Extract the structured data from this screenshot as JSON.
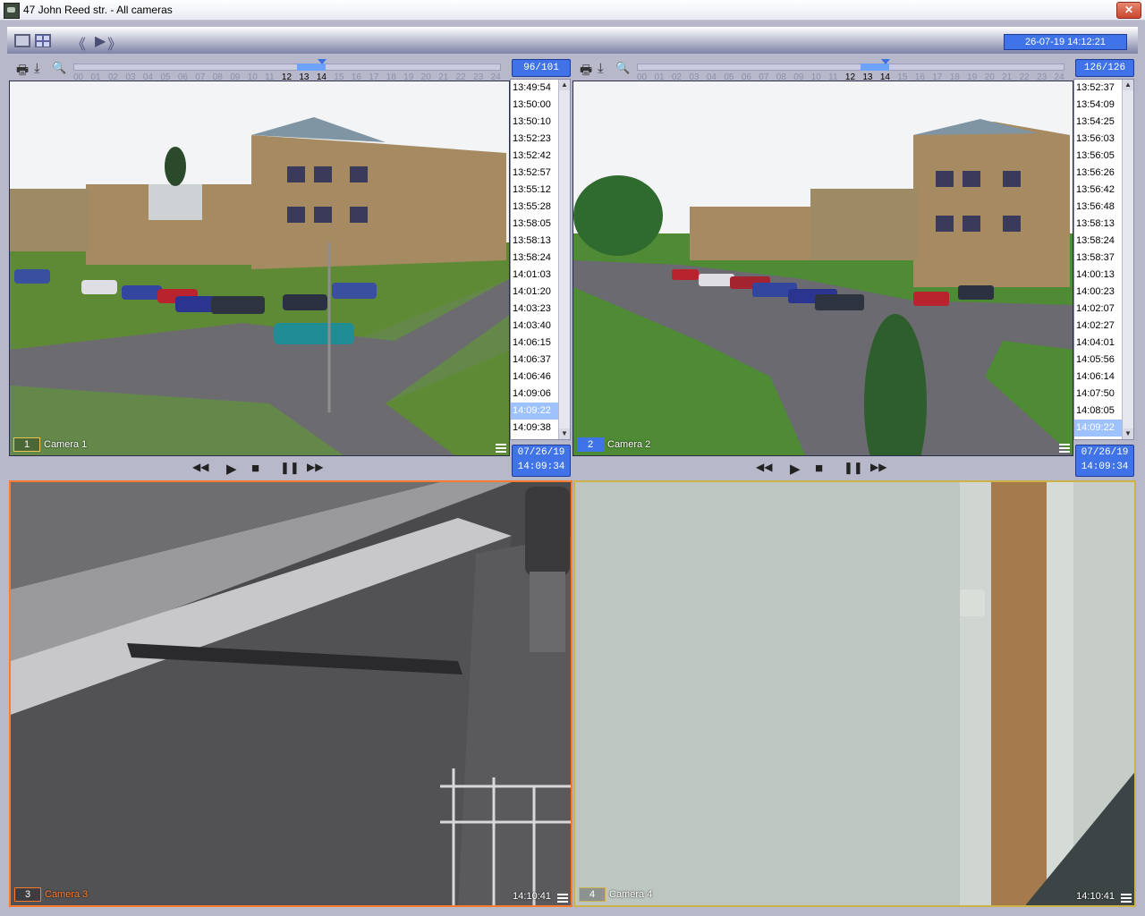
{
  "window": {
    "title": "47 John Reed str. - All cameras",
    "close_glyph": "✕"
  },
  "toolbar": {
    "datetime": "26-07-19 14:12:21",
    "prev_glyph": "《",
    "play_glyph": "▶",
    "next_glyph": "》"
  },
  "timeline_hours": [
    "00",
    "01",
    "02",
    "03",
    "04",
    "05",
    "06",
    "07",
    "08",
    "09",
    "10",
    "11",
    "12",
    "13",
    "14",
    "15",
    "16",
    "17",
    "18",
    "19",
    "20",
    "21",
    "22",
    "23",
    "24"
  ],
  "active_hours": [
    "12",
    "13",
    "14"
  ],
  "panel1": {
    "counter": "96/101",
    "date": "07/26/19",
    "time": "14:09:34",
    "events": [
      "13:49:54",
      "13:50:00",
      "13:50:10",
      "13:52:23",
      "13:52:42",
      "13:52:57",
      "13:55:12",
      "13:55:28",
      "13:58:05",
      "13:58:13",
      "13:58:24",
      "14:01:03",
      "14:01:20",
      "14:03:23",
      "14:03:40",
      "14:06:15",
      "14:06:37",
      "14:06:46",
      "14:09:06",
      "14:09:22",
      "14:09:38"
    ],
    "selected_event": "14:09:22"
  },
  "panel2": {
    "counter": "126/126",
    "date": "07/26/19",
    "time": "14:09:34",
    "events": [
      "13:52:37",
      "13:54:09",
      "13:54:25",
      "13:56:03",
      "13:56:05",
      "13:56:26",
      "13:56:42",
      "13:56:48",
      "13:58:13",
      "13:58:24",
      "13:58:37",
      "14:00:13",
      "14:00:23",
      "14:02:07",
      "14:02:27",
      "14:04:01",
      "14:05:56",
      "14:06:14",
      "14:07:50",
      "14:08:05",
      "14:09:22"
    ],
    "selected_event": "14:09:22"
  },
  "cameras": [
    {
      "number": "1",
      "name": "Camera 1"
    },
    {
      "number": "2",
      "name": "Camera 2"
    },
    {
      "number": "3",
      "name": "Camera 3",
      "clock": "14:10:41"
    },
    {
      "number": "4",
      "name": "Camera 4",
      "clock": "14:10:41"
    }
  ],
  "icons": {
    "print": "🖶",
    "download": "⤓",
    "zoom": "🔍",
    "rewind": "◀◀",
    "play": "▶",
    "stop": "■",
    "pause": "❚❚",
    "forward": "▶▶"
  },
  "colors": {
    "accent": "#3f73e7",
    "camera3_border": "#ff7a2a",
    "camera4_border": "#cdb24a"
  }
}
